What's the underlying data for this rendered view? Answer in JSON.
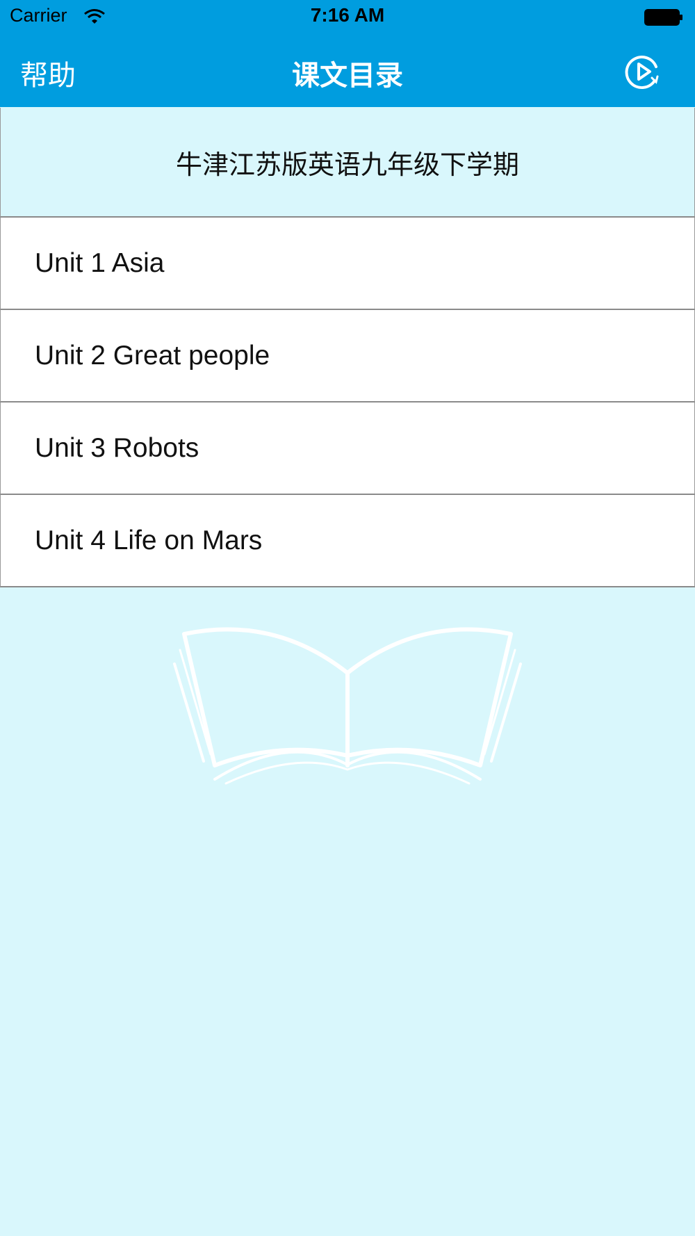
{
  "status_bar": {
    "carrier": "Carrier",
    "time": "7:16 AM",
    "icons": [
      "wifi-icon",
      "battery-icon"
    ]
  },
  "nav_bar": {
    "help_label": "帮助",
    "title": "课文目录",
    "play_icon": "play-circle-icon"
  },
  "book": {
    "title": "牛津江苏版英语九年级下学期",
    "units": [
      {
        "label": "Unit 1 Asia"
      },
      {
        "label": "Unit 2 Great people"
      },
      {
        "label": "Unit 3 Robots"
      },
      {
        "label": "Unit 4 Life on Mars"
      }
    ]
  },
  "illustration": {
    "icon": "open-book-icon"
  },
  "colors": {
    "nav_background": "#009ddf",
    "page_background": "#d9f7fc",
    "row_background": "#ffffff",
    "divider": "#8a8a8a"
  }
}
